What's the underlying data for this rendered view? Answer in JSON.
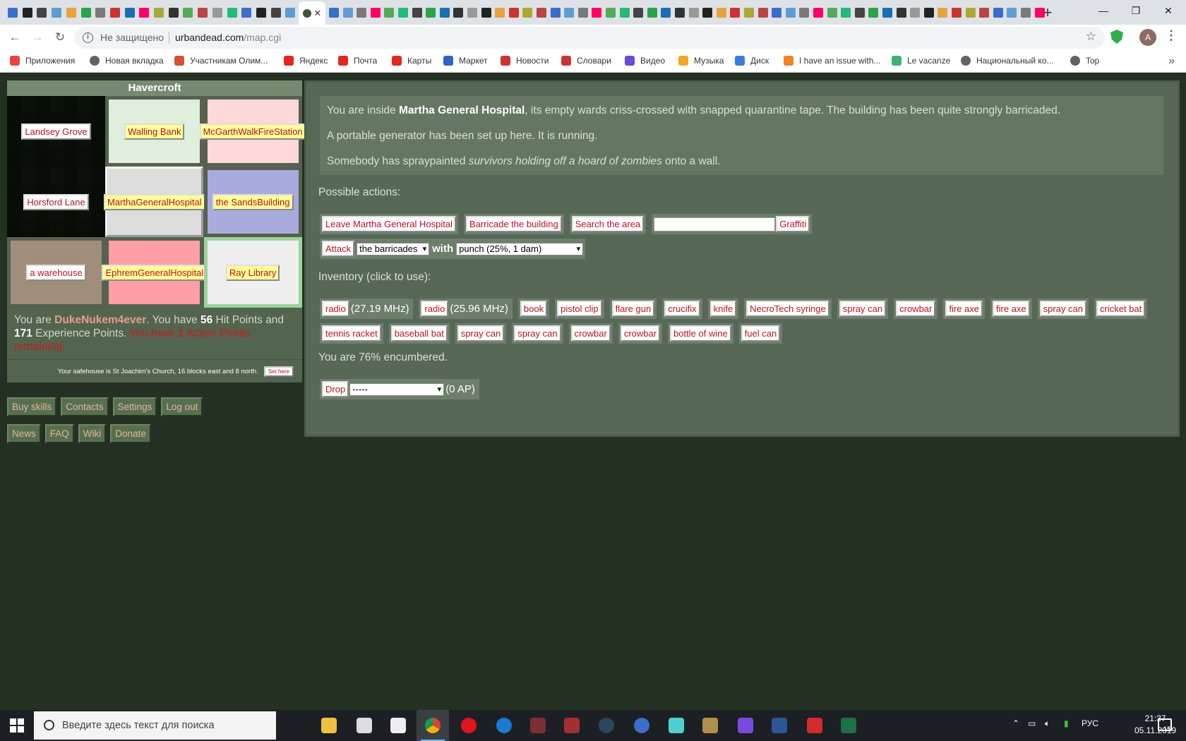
{
  "browser": {
    "active_tab_close": "✕",
    "new_tab": "+",
    "window_controls": {
      "minimize": "—",
      "maximize": "❐",
      "close": "✕"
    },
    "security_label": "Не защищено",
    "url_host": "urbandead.com",
    "url_path": "/map.cgi",
    "profile_initial": "A",
    "bookmarks": [
      {
        "label": "Приложения",
        "icon": "apps-grid-icon",
        "color": "#e8453c"
      },
      {
        "label": "Новая вкладка",
        "icon": "globe-icon",
        "color": "#5f6368"
      },
      {
        "label": "Участникам Олим...",
        "icon": "bookmark-icon",
        "color": "#d4522f"
      },
      {
        "label": "Яндекс",
        "icon": "yandex-icon",
        "color": "#e52620"
      },
      {
        "label": "Почта",
        "icon": "mail-icon",
        "color": "#e52620"
      },
      {
        "label": "Карты",
        "icon": "map-pin-icon",
        "color": "#e52620"
      },
      {
        "label": "Маркет",
        "icon": "cart-icon",
        "color": "#3062c0"
      },
      {
        "label": "Новости",
        "icon": "news-icon",
        "color": "#c33"
      },
      {
        "label": "Словари",
        "icon": "dictionary-icon",
        "color": "#c33"
      },
      {
        "label": "Видео",
        "icon": "video-icon",
        "color": "#6a4bdb"
      },
      {
        "label": "Музыка",
        "icon": "music-icon",
        "color": "#f5a623"
      },
      {
        "label": "Диск",
        "icon": "disk-icon",
        "color": "#3a7be0"
      },
      {
        "label": "I have an issue with...",
        "icon": "stackoverflow-icon",
        "color": "#f48024"
      },
      {
        "label": "Le vacanze",
        "icon": "duolingo-icon",
        "color": "#3cb371"
      },
      {
        "label": "Национальный ко...",
        "icon": "globe-icon",
        "color": "#5f6368"
      },
      {
        "label": "Top",
        "icon": "globe-icon",
        "color": "#5f6368"
      }
    ]
  },
  "location": {
    "title": "Havercroft",
    "grid": [
      {
        "label": "Landsey Grove",
        "bg": "#56614f",
        "white": true
      },
      {
        "label": "Walling Bank",
        "bg": "#dfeedd",
        "white": false
      },
      {
        "label": "McGarthWalkFireStation",
        "bg": "#ffd9d9",
        "white": false
      },
      {
        "label": "Horsford Lane",
        "bg": "#56614f",
        "white": true
      },
      {
        "label": "MarthaGeneralHospital",
        "bg": "#dcdcdc",
        "white": false
      },
      {
        "label": "the SandsBuilding",
        "bg": "#a9abde",
        "white": false
      },
      {
        "label": "a warehouse",
        "bg": "#a08e7a",
        "white": true
      },
      {
        "label": "EphremGeneralHospital",
        "bg": "#ff9fa5",
        "white": false
      },
      {
        "label": "Ray Library",
        "bg": "#eeeeee",
        "white": false
      }
    ]
  },
  "status": {
    "prefix": "You are ",
    "name": "DukeNukem4ever",
    "mid1": ". You have ",
    "hp": "56",
    "mid2": " Hit Points and ",
    "xp": "171",
    "mid3": " Experience Points. ",
    "ap_pre": "You have ",
    "ap": "1",
    "ap_post": " Action Points remaining."
  },
  "safehouse": {
    "text": "Your safehouse is St Joachim's Church, 16 blocks east and 8 north.",
    "button": "Set here"
  },
  "nav": {
    "row1": [
      "Buy skills",
      "Contacts",
      "Settings",
      "Log out"
    ],
    "row2": [
      "News",
      "FAQ",
      "Wiki",
      "Donate"
    ]
  },
  "description": {
    "p1_pre": "You are inside ",
    "p1_bold": "Martha General Hospital",
    "p1_post": ", its empty wards criss-crossed with snapped quarantine tape. The building has been quite strongly barricaded.",
    "p2": "A portable generator has been set up here. It is running.",
    "p3_pre": "Somebody has spraypainted ",
    "p3_italic": "survivors holding off a hoard of zombies",
    "p3_post": " onto a wall."
  },
  "actions": {
    "heading": "Possible actions:",
    "leave": "Leave Martha General Hospital",
    "barricade": "Barricade the building",
    "search": "Search the area",
    "graffiti_value": "",
    "graffiti": "Graffiti",
    "attack": "Attack",
    "attack_target": "the barricades",
    "with": "with",
    "weapon": "punch (25%, 1 dam)"
  },
  "inventory": {
    "heading": "Inventory (click to use):",
    "radios": [
      {
        "label": "radio",
        "freq": "(27.19 MHz)"
      },
      {
        "label": "radio",
        "freq": "(25.96 MHz)"
      }
    ],
    "row1": [
      "book",
      "pistol clip",
      "flare gun",
      "crucifix",
      "knife",
      "NecroTech syringe",
      "spray can",
      "crowbar",
      "fire axe",
      "fire axe",
      "spray can",
      "cricket bat"
    ],
    "row2": [
      "tennis racket",
      "baseball bat",
      "spray can",
      "spray can",
      "crowbar",
      "crowbar",
      "bottle of wine",
      "fuel can"
    ],
    "encumbered": "You are 76% encumbered.",
    "drop": "Drop",
    "drop_select": "-----",
    "drop_cost": "(0 AP)"
  },
  "taskbar": {
    "search_placeholder": "Введите здесь текст для поиска",
    "lang": "РУС",
    "time": "21:37",
    "date": "05.11.2019",
    "notifications": "15"
  }
}
